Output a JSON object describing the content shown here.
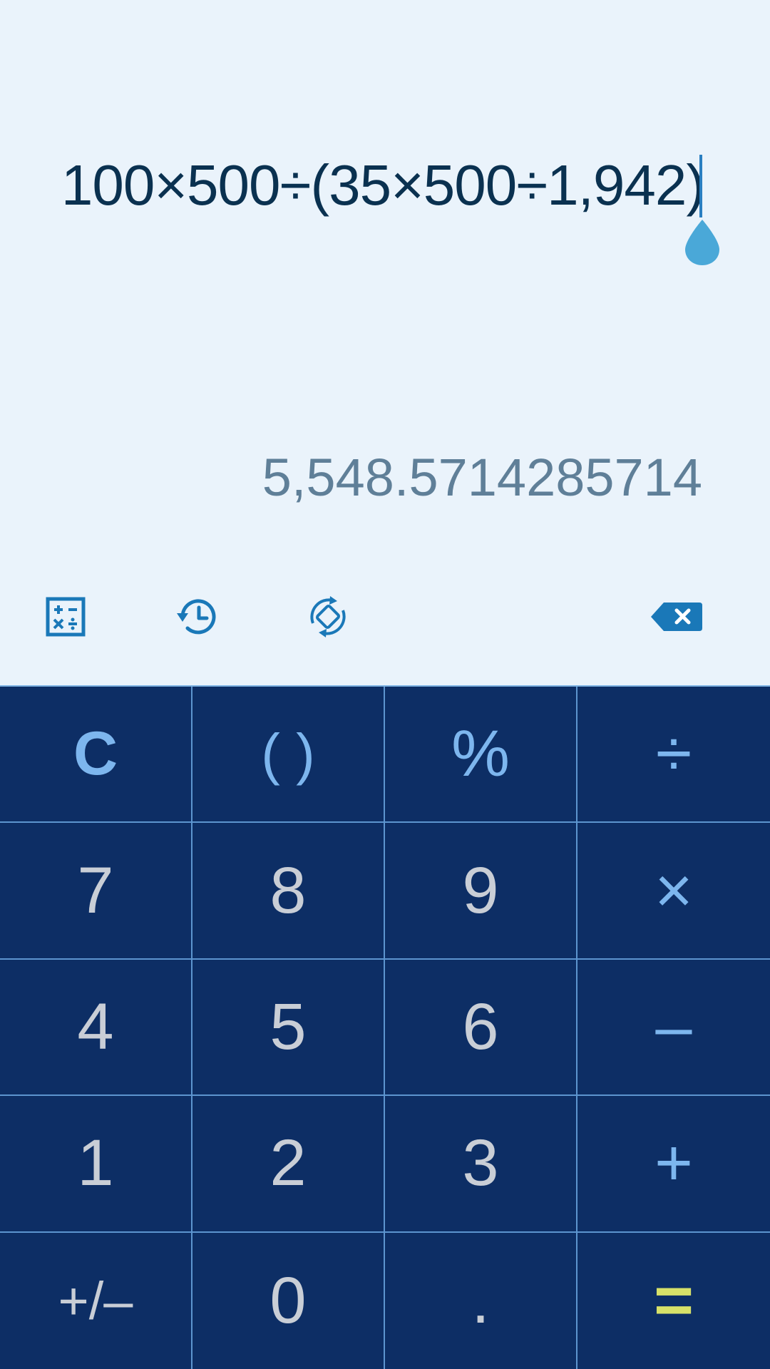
{
  "display": {
    "expression": "100×500÷(35×500÷1,942)",
    "result": "5,548.5714285714"
  },
  "toolbar": {
    "items": [
      {
        "name": "unit-converter-icon",
        "label": ""
      },
      {
        "name": "history-icon",
        "label": ""
      },
      {
        "name": "rotate-scientific-icon",
        "label": ""
      },
      {
        "name": "backspace-icon",
        "label": ""
      }
    ]
  },
  "keypad": {
    "keys": [
      {
        "label": "C",
        "type": "clear"
      },
      {
        "label": "( )",
        "type": "paren"
      },
      {
        "label": "%",
        "type": "op"
      },
      {
        "label": "÷",
        "type": "op"
      },
      {
        "label": "7",
        "type": "digit"
      },
      {
        "label": "8",
        "type": "digit"
      },
      {
        "label": "9",
        "type": "digit"
      },
      {
        "label": "×",
        "type": "op"
      },
      {
        "label": "4",
        "type": "digit"
      },
      {
        "label": "5",
        "type": "digit"
      },
      {
        "label": "6",
        "type": "digit"
      },
      {
        "label": "–",
        "type": "op"
      },
      {
        "label": "1",
        "type": "digit"
      },
      {
        "label": "2",
        "type": "digit"
      },
      {
        "label": "3",
        "type": "digit"
      },
      {
        "label": "+",
        "type": "op"
      },
      {
        "label": "+/–",
        "type": "sign"
      },
      {
        "label": "0",
        "type": "digit"
      },
      {
        "label": ".",
        "type": "digit"
      },
      {
        "label": "=",
        "type": "equals"
      }
    ]
  },
  "colors": {
    "display_bg": "#eaf3fb",
    "keypad_bg": "#0d2e65",
    "accent": "#7db6ee",
    "equals": "#d7e169",
    "icon": "#1a78b8"
  }
}
